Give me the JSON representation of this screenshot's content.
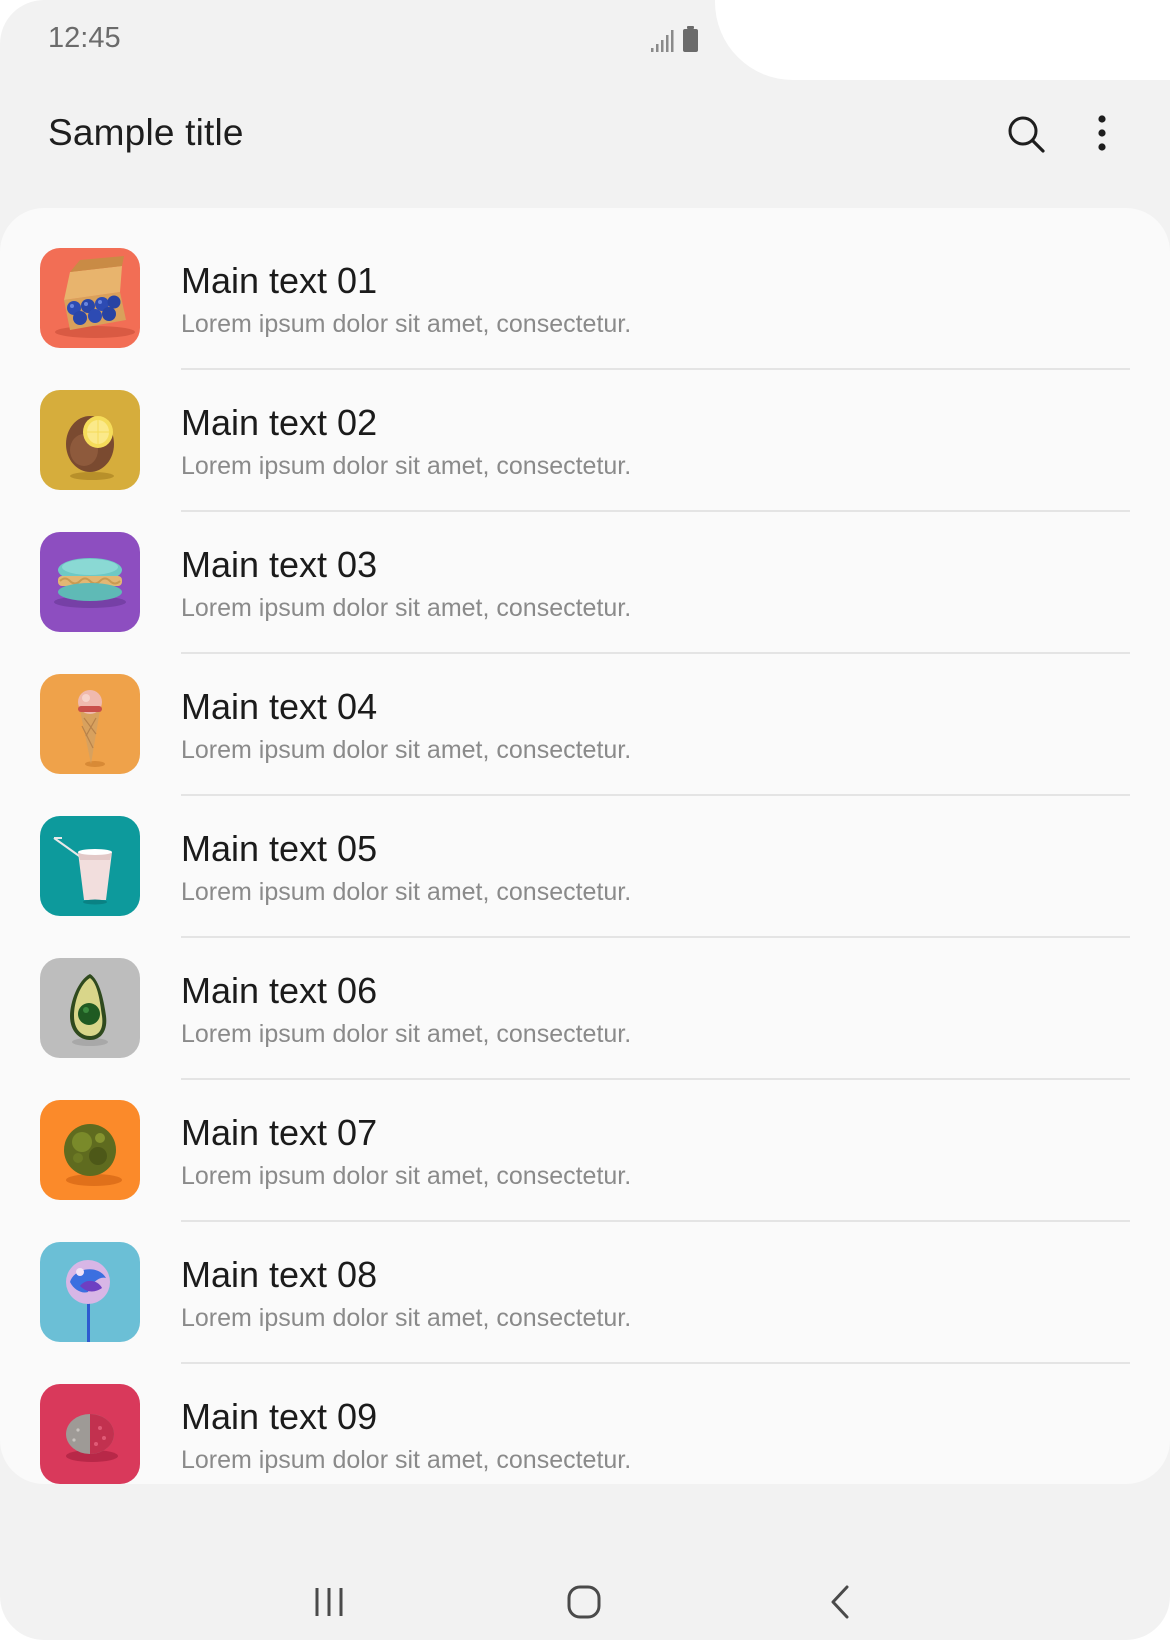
{
  "status_bar": {
    "time": "12:45",
    "icons": [
      "signal-icon",
      "battery-icon"
    ]
  },
  "app_bar": {
    "title": "Sample title",
    "actions": [
      "search-icon",
      "more-options-icon"
    ]
  },
  "list": {
    "items": [
      {
        "main": "Main text 01",
        "sub": "Lorem ipsum dolor sit amet, consectetur.",
        "thumb_color": "#f26e55",
        "thumb_subject": "egg-carton"
      },
      {
        "main": "Main text 02",
        "sub": "Lorem ipsum dolor sit amet, consectetur.",
        "thumb_color": "#d6ad3c",
        "thumb_subject": "kiwi-lemon"
      },
      {
        "main": "Main text 03",
        "sub": "Lorem ipsum dolor sit amet, consectetur.",
        "thumb_color": "#8d4ec0",
        "thumb_subject": "macaron"
      },
      {
        "main": "Main text 04",
        "sub": "Lorem ipsum dolor sit amet, consectetur.",
        "thumb_color": "#efa24a",
        "thumb_subject": "ice-cream-cone"
      },
      {
        "main": "Main text 05",
        "sub": "Lorem ipsum dolor sit amet, consectetur.",
        "thumb_color": "#0d9a9c",
        "thumb_subject": "drink-cup"
      },
      {
        "main": "Main text 06",
        "sub": "Lorem ipsum dolor sit amet, consectetur.",
        "thumb_color": "#bdbdbd",
        "thumb_subject": "avocado"
      },
      {
        "main": "Main text 07",
        "sub": "Lorem ipsum dolor sit amet, consectetur.",
        "thumb_color": "#fb8a2a",
        "thumb_subject": "moss-ball"
      },
      {
        "main": "Main text 08",
        "sub": "Lorem ipsum dolor sit amet, consectetur.",
        "thumb_color": "#6bbfd6",
        "thumb_subject": "lollipop"
      },
      {
        "main": "Main text 09",
        "sub": "Lorem ipsum dolor sit amet, consectetur.",
        "thumb_color": "#d9395b",
        "thumb_subject": "sponge"
      }
    ]
  },
  "nav_bar": {
    "buttons": [
      "recents-icon",
      "home-icon",
      "back-icon"
    ]
  },
  "colors": {
    "background": "#f2f2f2",
    "card": "#fafafa",
    "title_text": "#1e1e1e",
    "sub_text": "#8a8a8a",
    "divider": "#e4e4e4"
  }
}
